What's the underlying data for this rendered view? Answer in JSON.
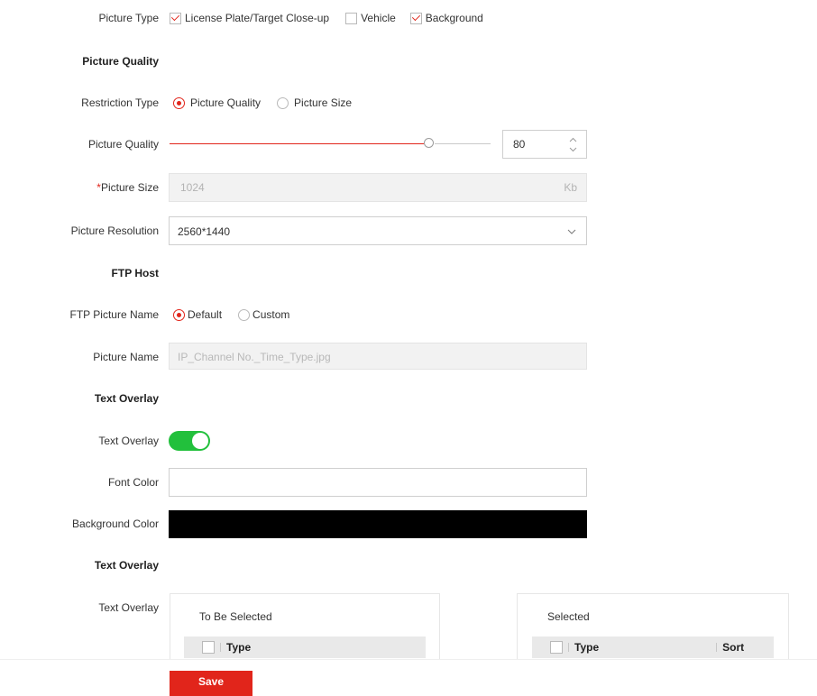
{
  "picture_type": {
    "label": "Picture Type",
    "options": [
      {
        "label": "License Plate/Target Close-up",
        "checked": true
      },
      {
        "label": "Vehicle",
        "checked": false
      },
      {
        "label": "Background",
        "checked": true
      }
    ]
  },
  "picture_quality_section": "Picture Quality",
  "restriction_type": {
    "label": "Restriction Type",
    "options": [
      {
        "label": "Picture Quality",
        "selected": true
      },
      {
        "label": "Picture Size",
        "selected": false
      }
    ]
  },
  "picture_quality": {
    "label": "Picture Quality",
    "value": "80",
    "slider_fraction": 0.8
  },
  "picture_size": {
    "required_mark": "*",
    "label": "Picture Size",
    "value": "1024",
    "unit": "Kb"
  },
  "picture_resolution": {
    "label": "Picture Resolution",
    "value": "2560*1440"
  },
  "ftp_host_section": "FTP Host",
  "ftp_picture_name": {
    "label": "FTP Picture Name",
    "options": [
      {
        "label": "Default",
        "selected": true
      },
      {
        "label": "Custom",
        "selected": false
      }
    ]
  },
  "picture_name": {
    "label": "Picture Name",
    "placeholder": "IP_Channel No._Time_Type.jpg"
  },
  "text_overlay_section_1": "Text Overlay",
  "text_overlay_toggle": {
    "label": "Text Overlay",
    "enabled": true,
    "color": "#22c03c"
  },
  "font_color": {
    "label": "Font Color",
    "value": "#ffffff"
  },
  "background_color": {
    "label": "Background Color",
    "value": "#000000"
  },
  "text_overlay_section_2": "Text Overlay",
  "text_overlay_list": {
    "label": "Text Overlay",
    "to_be_selected": {
      "title": "To Be Selected",
      "columns": [
        "Type"
      ]
    },
    "selected": {
      "title": "Selected",
      "columns": [
        "Type",
        "Sort"
      ]
    }
  },
  "save_label": "Save",
  "accent_color": "#e1251b"
}
